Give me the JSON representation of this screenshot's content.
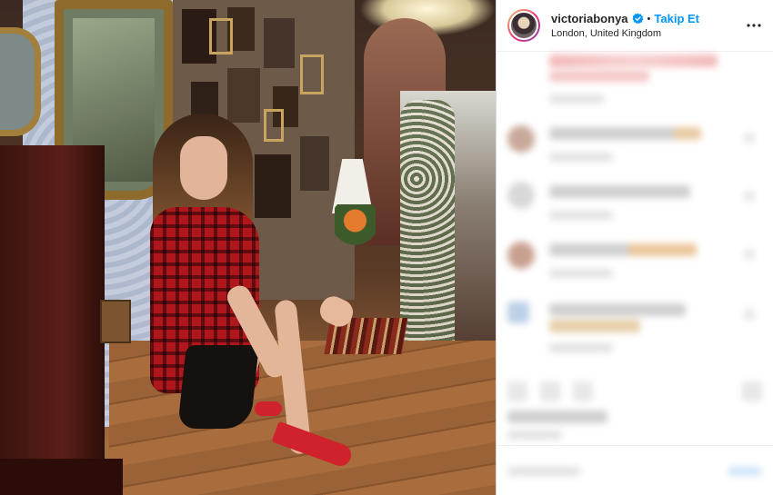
{
  "post": {
    "username": "victoriabonya",
    "separator": "•",
    "follow_label": "Takip Et",
    "location": "London, United Kingdom",
    "verified_icon": "verified-badge-icon",
    "more_icon": "more-options-icon"
  },
  "colors": {
    "accent": "#0095f6",
    "text": "#262626",
    "border": "#dbdbdb"
  }
}
